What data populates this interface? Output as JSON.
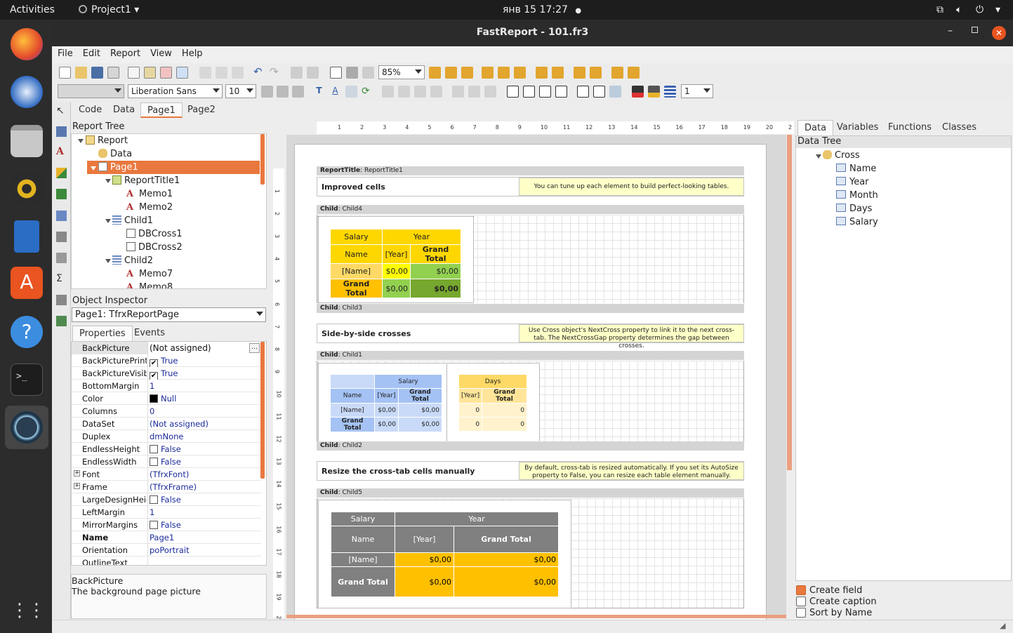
{
  "topbar": {
    "activities": "Activities",
    "app": "Project1",
    "clock": "янв 15  17:27"
  },
  "window": {
    "title": "FastReport - 101.fr3"
  },
  "menu": [
    "File",
    "Edit",
    "Report",
    "View",
    "Help"
  ],
  "toolbar": {
    "zoom": "85%",
    "font": "Liberation Sans",
    "size": "10",
    "frame_width": "1"
  },
  "designer_tabs": [
    "Code",
    "Data",
    "Page1",
    "Page2"
  ],
  "report_tree": {
    "title": "Report Tree",
    "nodes": [
      "Report",
      "Data",
      "Page1",
      "ReportTitle1",
      "Memo1",
      "Memo2",
      "Child1",
      "DBCross1",
      "DBCross2",
      "Child2",
      "Memo7",
      "Memo8"
    ]
  },
  "object_inspector": {
    "title": "Object Inspector",
    "selected": "Page1: TfrxReportPage",
    "tabs": [
      "Properties",
      "Events"
    ],
    "props": [
      {
        "name": "BackPicture",
        "value": "(Not assigned)"
      },
      {
        "name": "BackPicturePrintable",
        "value": "True"
      },
      {
        "name": "BackPictureVisible",
        "value": "True"
      },
      {
        "name": "BottomMargin",
        "value": "1"
      },
      {
        "name": "Color",
        "value": "Null"
      },
      {
        "name": "Columns",
        "value": "0"
      },
      {
        "name": "DataSet",
        "value": "(Not assigned)"
      },
      {
        "name": "Duplex",
        "value": "dmNone"
      },
      {
        "name": "EndlessHeight",
        "value": "False"
      },
      {
        "name": "EndlessWidth",
        "value": "False"
      },
      {
        "name": "Font",
        "value": "(TfrxFont)"
      },
      {
        "name": "Frame",
        "value": "(TfrxFrame)"
      },
      {
        "name": "LargeDesignHeight",
        "value": "False"
      },
      {
        "name": "LeftMargin",
        "value": "1"
      },
      {
        "name": "MirrorMargins",
        "value": "False"
      },
      {
        "name": "Name",
        "value": "Page1"
      },
      {
        "name": "Orientation",
        "value": "poPortrait"
      },
      {
        "name": "OutlineText",
        "value": ""
      }
    ],
    "hint_title": "BackPicture",
    "hint_text": "The background page picture"
  },
  "ruler": [
    "1",
    "2",
    "3",
    "4",
    "5",
    "6",
    "7",
    "8",
    "9",
    "10",
    "11",
    "12",
    "13",
    "14",
    "15",
    "16",
    "17",
    "18",
    "19",
    "20",
    "2"
  ],
  "vruler": [
    "1",
    "2",
    "3",
    "4",
    "5",
    "6",
    "7",
    "8",
    "9",
    "10",
    "11",
    "12",
    "13",
    "14",
    "15",
    "16",
    "17",
    "18",
    "19",
    "20"
  ],
  "bands": {
    "report_title": {
      "kind": "ReportTitle",
      "name": "ReportTitle1"
    },
    "child4": {
      "kind": "Child",
      "name": "Child4"
    },
    "child3": {
      "kind": "Child",
      "name": "Child3"
    },
    "child1": {
      "kind": "Child",
      "name": "Child1"
    },
    "child2": {
      "kind": "Child",
      "name": "Child2"
    },
    "child5": {
      "kind": "Child",
      "name": "Child5"
    }
  },
  "sections": {
    "s1": {
      "title": "Improved cells",
      "note": "You can tune up each element to build perfect-looking tables."
    },
    "s2": {
      "title": "Side-by-side crosses",
      "note": "Use Cross object's NextCross property to link it to the next cross-tab. The NextCrossGap property determines the gap between crosses."
    },
    "s3": {
      "title": "Resize the cross-tab cells manually",
      "note": "By default, cross-tab is resized automatically. If you set its AutoSize property to False, you can resize each table element manually."
    }
  },
  "cross1": {
    "salary": "Salary",
    "year": "Year",
    "name": "Name",
    "year_f": "[Year]",
    "grand": "Grand Total",
    "name_f": "[Name]",
    "v1": "$0,00",
    "v2": "$0,00",
    "gt": "Grand Total",
    "v3": "$0,00",
    "v4": "$0,00"
  },
  "cross2a": {
    "salary": "Salary",
    "name": "Name",
    "year_f": "[Year]",
    "grand": "Grand Total",
    "name_f": "[Name]",
    "v1": "$0,00",
    "v2": "$0,00",
    "gt": "Grand Total",
    "v3": "$0,00",
    "v4": "$0,00"
  },
  "cross2b": {
    "days": "Days",
    "year_f": "[Year]",
    "grand": "Grand Total",
    "v1": "0",
    "v2": "0",
    "v3": "0",
    "v4": "0"
  },
  "cross3": {
    "salary": "Salary",
    "year": "Year",
    "name": "Name",
    "year_f": "[Year]",
    "grand": "Grand Total",
    "name_f": "[Name]",
    "v1": "$0,00",
    "v2": "$0,00",
    "gt": "Grand Total",
    "v3": "$0,00",
    "v4": "$0,00"
  },
  "data_panel": {
    "tabs": [
      "Data",
      "Variables",
      "Functions",
      "Classes"
    ],
    "tree_title": "Data Tree",
    "dataset": "Cross",
    "fields": [
      "Name",
      "Year",
      "Month",
      "Days",
      "Salary"
    ],
    "options": {
      "create_field": "Create field",
      "create_caption": "Create caption",
      "sort_by_name": "Sort by Name"
    }
  },
  "colors": {
    "accent": "#e9783e",
    "yellow_head": "#ffd700",
    "blue_head": "#a4c2f4",
    "gray_head": "#808080",
    "gold_cell": "#ffc000"
  }
}
